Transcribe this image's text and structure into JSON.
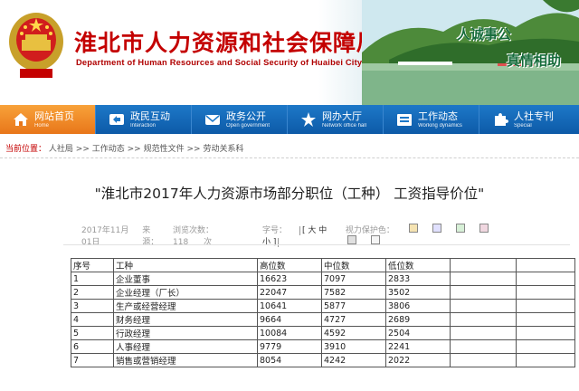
{
  "header": {
    "title": "淮北市人力资源和社会保障局",
    "subtitle": "Department of Human Resources and Social Security of Huaibei City",
    "slogan_1": "人诚事公",
    "slogan_2": "真情相助"
  },
  "nav": {
    "items": [
      {
        "label": "网站首页",
        "en": "Home",
        "icon": "home-icon"
      },
      {
        "label": "政民互动",
        "en": "Interaction",
        "icon": "interaction-icon"
      },
      {
        "label": "政务公开",
        "en": "Open government",
        "icon": "mail-icon"
      },
      {
        "label": "网办大厅",
        "en": "Network office hall",
        "icon": "star-icon"
      },
      {
        "label": "工作动态",
        "en": "Working dynamics",
        "icon": "folder-icon"
      },
      {
        "label": "人社专刊",
        "en": "Special",
        "icon": "puzzle-icon"
      }
    ]
  },
  "breadcrumb": {
    "prefix": "当前位置：",
    "items": [
      "人社局",
      "工作动态",
      "规范性文件",
      "劳动关系科"
    ],
    "separator": ">>"
  },
  "article": {
    "title": "\"淮北市2017年人力资源市场部分职位（工种） 工资指导价位\"",
    "date": "2017年11月01日",
    "source_label": "来源：",
    "views_label": "浏览次数：",
    "views": "118",
    "views_unit": "次",
    "fontsize_label": "字号：",
    "fontsize": "[ 大 中 小 ]",
    "eye_label": "视力保护色：",
    "eye_colors": [
      "#f5e3b2",
      "#e0e0ff",
      "#d7f0d7",
      "#f0d7e0",
      "#e0e0e0",
      "#f5f5f5"
    ]
  },
  "table": {
    "headers": [
      "序号",
      "工种",
      "高位数",
      "中位数",
      "低位数",
      "",
      ""
    ],
    "rows": [
      [
        "1",
        "企业董事",
        "16623",
        "7097",
        "2833",
        "",
        ""
      ],
      [
        "2",
        "企业经理（厂长）",
        "22047",
        "7582",
        "3502",
        "",
        ""
      ],
      [
        "3",
        "生产或经营经理",
        "10641",
        "5877",
        "3806",
        "",
        ""
      ],
      [
        "4",
        "财务经理",
        "9664",
        "4727",
        "2689",
        "",
        ""
      ],
      [
        "5",
        "行政经理",
        "10084",
        "4592",
        "2504",
        "",
        ""
      ],
      [
        "6",
        "人事经理",
        "9779",
        "3910",
        "2241",
        "",
        ""
      ],
      [
        "7",
        "销售或营销经理",
        "8054",
        "4242",
        "2022",
        "",
        ""
      ]
    ]
  }
}
